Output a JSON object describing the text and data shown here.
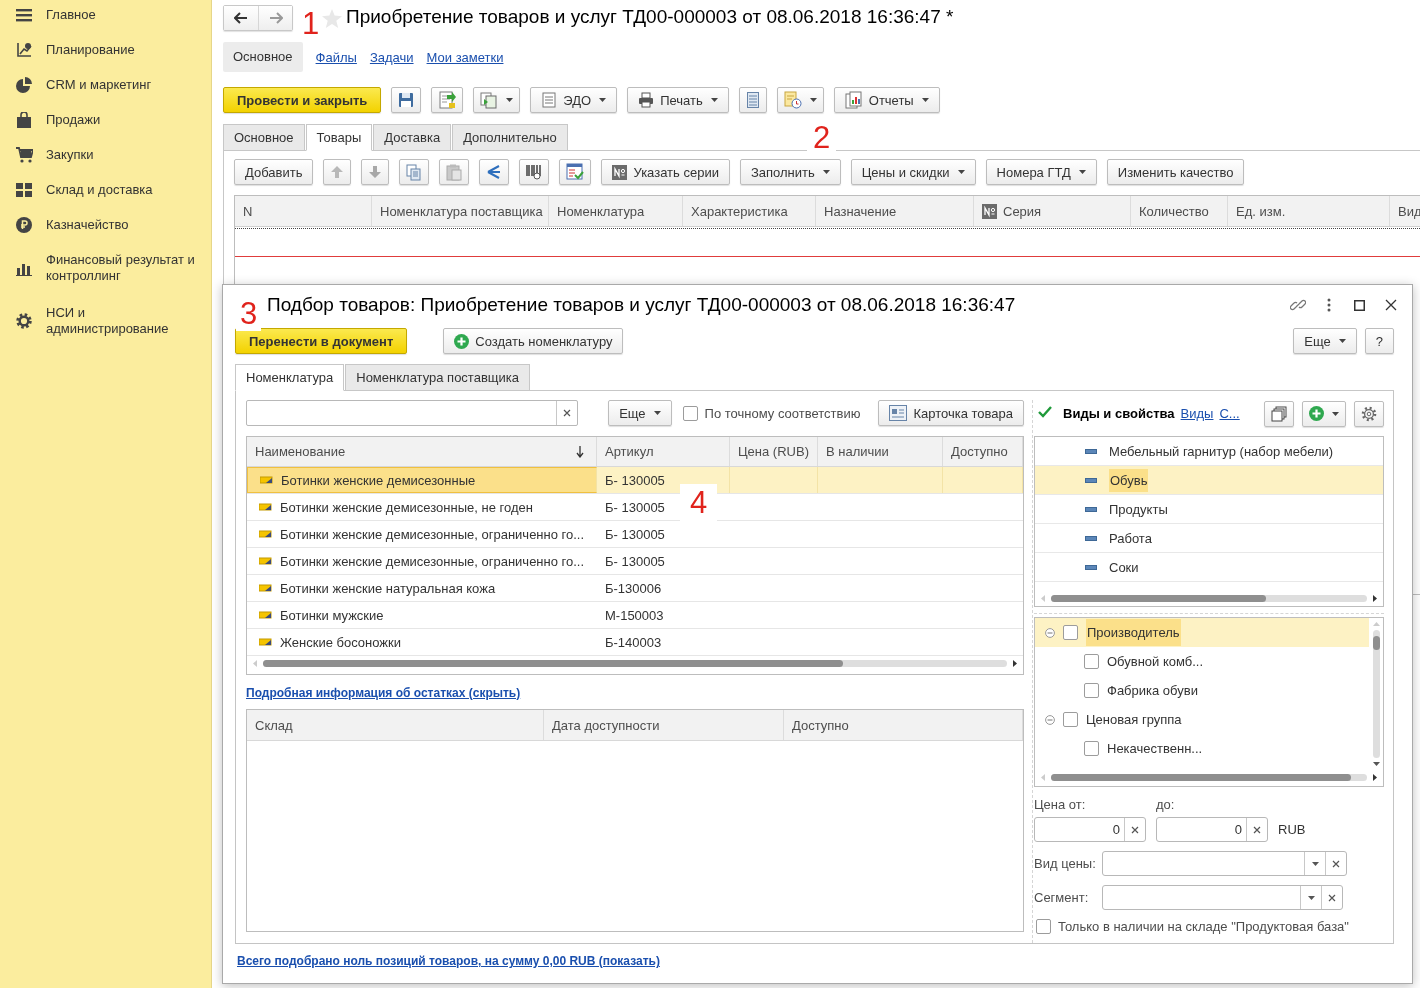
{
  "sidebar": {
    "items": [
      {
        "label": "Главное"
      },
      {
        "label": "Планирование"
      },
      {
        "label": "CRM и маркетинг"
      },
      {
        "label": "Продажи"
      },
      {
        "label": "Закупки"
      },
      {
        "label": "Склад и доставка"
      },
      {
        "label": "Казначейство"
      },
      {
        "label": "Финансовый результат и контроллинг"
      },
      {
        "label": "НСИ и администрирование"
      }
    ]
  },
  "document": {
    "title": "Приобретение товаров и услуг ТД00-000003 от 08.06.2018 16:36:47 *",
    "sections": [
      {
        "label": "Основное",
        "selected": true
      },
      {
        "label": "Файлы",
        "selected": false
      },
      {
        "label": "Задачи",
        "selected": false
      },
      {
        "label": "Мои заметки",
        "selected": false
      }
    ],
    "toolbar": [
      {
        "kind": "primary",
        "label": "Провести и закрыть",
        "dropdown": false
      },
      {
        "kind": "icon",
        "dropdown": false
      },
      {
        "kind": "icon",
        "dropdown": false
      },
      {
        "kind": "icon",
        "dropdown": true
      },
      {
        "kind": "text",
        "label": "ЭДО",
        "dropdown": true
      },
      {
        "kind": "text",
        "label": "Печать",
        "dropdown": true
      },
      {
        "kind": "icon",
        "dropdown": false
      },
      {
        "kind": "icon",
        "dropdown": true
      },
      {
        "kind": "text",
        "label": "Отчеты",
        "dropdown": true
      }
    ],
    "tabs": [
      {
        "label": "Основное",
        "selected": false
      },
      {
        "label": "Товары",
        "selected": true
      },
      {
        "label": "Доставка",
        "selected": false
      },
      {
        "label": "Дополнительно",
        "selected": false
      }
    ],
    "table_toolbar": [
      {
        "kind": "text",
        "label": "Добавить",
        "dropdown": false
      },
      {
        "kind": "icon",
        "dropdown": false
      },
      {
        "kind": "icon",
        "dropdown": false
      },
      {
        "kind": "icon",
        "dropdown": false
      },
      {
        "kind": "icon",
        "dropdown": false
      },
      {
        "kind": "icon",
        "dropdown": false
      },
      {
        "kind": "icon",
        "dropdown": false
      },
      {
        "kind": "icon",
        "dropdown": false
      },
      {
        "kind": "text",
        "label": "Указать серии",
        "dropdown": false
      },
      {
        "kind": "text",
        "label": "Заполнить",
        "dropdown": true
      },
      {
        "kind": "text",
        "label": "Цены и скидки",
        "dropdown": true
      },
      {
        "kind": "text",
        "label": "Номера ГТД",
        "dropdown": true
      },
      {
        "kind": "text",
        "label": "Изменить качество",
        "dropdown": false
      }
    ],
    "columns": [
      {
        "label": "N"
      },
      {
        "label": "Номенклатура поставщика"
      },
      {
        "label": "Номенклатура"
      },
      {
        "label": "Характеристика"
      },
      {
        "label": "Назначение"
      },
      {
        "label": "Серия"
      },
      {
        "label": "Количество"
      },
      {
        "label": "Ед. изм."
      },
      {
        "label": "Вид"
      }
    ]
  },
  "picker": {
    "title": "Подбор товаров: Приобретение товаров и услуг ТД00-000003 от 08.06.2018 16:36:47",
    "actions": [
      {
        "kind": "primary",
        "label": "Перенести в документ",
        "dropdown": false
      },
      {
        "kind": "text",
        "label": "Создать номенклатуру",
        "dropdown": false
      }
    ],
    "window_actions": [
      {
        "kind": "text",
        "label": "Еще",
        "dropdown": true
      },
      {
        "kind": "text",
        "label": "?",
        "dropdown": false
      }
    ],
    "tabs": [
      {
        "label": "Номенклатура",
        "selected": true
      },
      {
        "label": "Номенклатура поставщика",
        "selected": false
      }
    ],
    "more_button": {
      "kind": "text",
      "label": "Еще",
      "dropdown": true
    },
    "exact_match": {
      "label": "По точному соответствию",
      "checked": false
    },
    "card_button": {
      "kind": "text",
      "label": "Карточка товара",
      "dropdown": false
    },
    "products": {
      "columns": [
        {
          "label": "Наименование",
          "sorted": true
        },
        {
          "label": "Артикул",
          "sorted": false
        },
        {
          "label": "Цена (RUB)",
          "sorted": false
        },
        {
          "label": "В наличии",
          "sorted": false
        },
        {
          "label": "Доступно",
          "sorted": false
        }
      ],
      "rows": [
        {
          "name": "Ботинки женские демисезонные",
          "article": "Б- 130005",
          "selected": true
        },
        {
          "name": "Ботинки женские демисезонные, не годен",
          "article": "Б- 130005",
          "selected": false
        },
        {
          "name": "Ботинки женские демисезонные, ограниченно го...",
          "article": "Б- 130005",
          "selected": false
        },
        {
          "name": "Ботинки женские демисезонные, ограниченно го...",
          "article": "Б- 130005",
          "selected": false
        },
        {
          "name": "Ботинки женские натуральная кожа",
          "article": "Б-130006",
          "selected": false
        },
        {
          "name": "Ботинки мужские",
          "article": "М-150003",
          "selected": false
        },
        {
          "name": "Женские босоножки",
          "article": "Б-140003",
          "selected": false
        }
      ]
    },
    "stock_link": "Подробная информация об остатках (скрыть)",
    "stock": {
      "columns": [
        {
          "label": "Склад"
        },
        {
          "label": "Дата доступности"
        },
        {
          "label": "Доступно"
        }
      ]
    },
    "properties": {
      "toggle": {
        "label": "Виды и свойства",
        "checked": true
      },
      "links": [
        "Виды",
        "С..."
      ],
      "kinds": [
        {
          "label": "Мебельный гарнитур (набор мебели)",
          "selected": false
        },
        {
          "label": "Обувь",
          "selected": true
        },
        {
          "label": "Продукты",
          "selected": false
        },
        {
          "label": "Работа",
          "selected": false
        },
        {
          "label": "Соки",
          "selected": false
        }
      ],
      "tree": [
        {
          "label": "Производитель",
          "checked": false,
          "expanded": true,
          "selected": true,
          "children": [
            {
              "label": "Обувной комб...",
              "checked": false,
              "selected": false
            },
            {
              "label": "Фабрика обуви",
              "checked": false,
              "selected": false
            }
          ]
        },
        {
          "label": "Ценовая группа",
          "checked": false,
          "expanded": true,
          "selected": false,
          "children": [
            {
              "label": "Некачественн...",
              "checked": false,
              "selected": false
            }
          ]
        }
      ]
    },
    "price": {
      "from_label": "Цена от:",
      "from_value": "0",
      "to_label": "до:",
      "to_value": "0",
      "currency": "RUB"
    },
    "price_type": {
      "label": "Вид цены:"
    },
    "segment": {
      "label": "Сегмент:"
    },
    "in_stock": {
      "label": "Только в наличии на складе \"Продуктовая база\"",
      "checked": false
    },
    "summary_link": "Всего подобрано ноль позиций товаров, на сумму 0,00 RUB (показать)"
  },
  "annotations": [
    {
      "label": "1"
    },
    {
      "label": "2"
    },
    {
      "label": "3"
    },
    {
      "label": "4"
    }
  ]
}
